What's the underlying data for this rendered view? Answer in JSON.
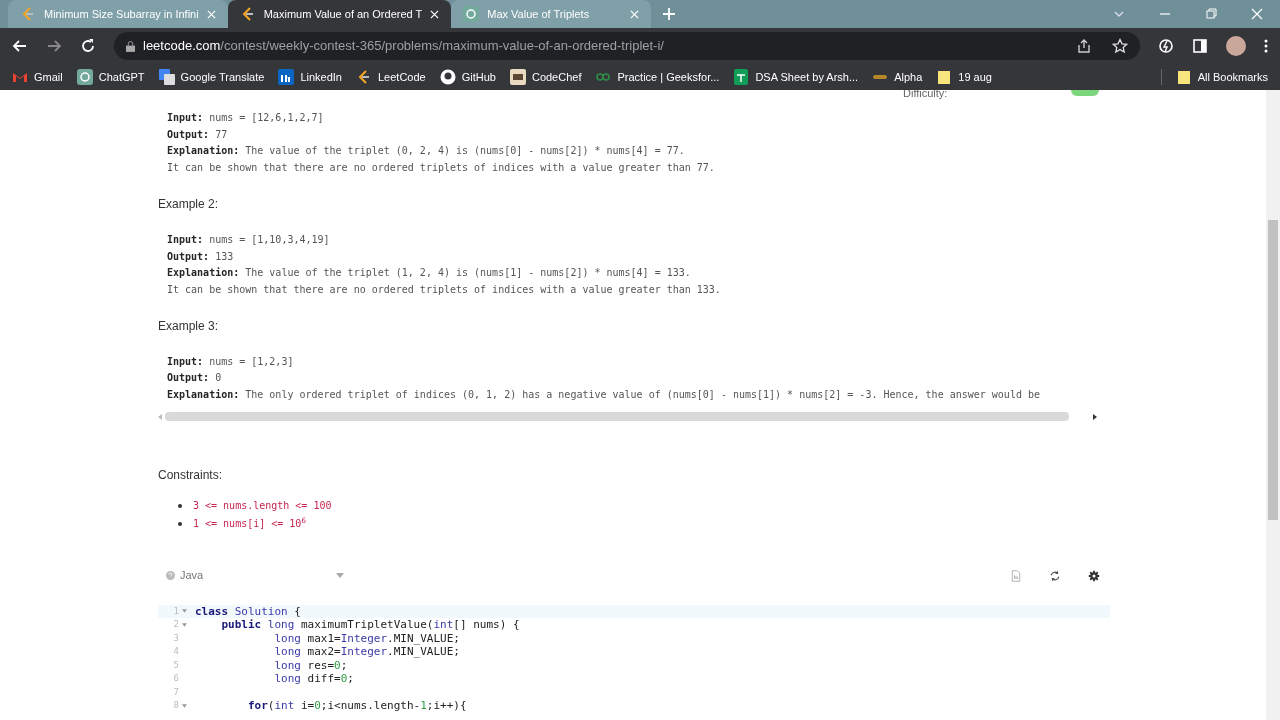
{
  "browser": {
    "tabs": [
      {
        "title": "Minimum Size Subarray in Infini",
        "selected": false
      },
      {
        "title": "Maximum Value of an Ordered T",
        "selected": true
      },
      {
        "title": "Max Value of Triplets",
        "selected": false
      }
    ],
    "url_domain": "leetcode.com",
    "url_path": "/contest/weekly-contest-365/problems/maximum-value-of-an-ordered-triplet-i/",
    "bookmarks": [
      "Gmail",
      "ChatGPT",
      "Google Translate",
      "LinkedIn",
      "LeetCode",
      "GitHub",
      "CodeChef",
      "Practice | Geeksfor...",
      "DSA Sheet by Arsh...",
      "Alpha",
      "19 aug"
    ],
    "all_bookmarks": "All Bookmarks"
  },
  "difficulty_label": "Difficulty:",
  "examples": [
    {
      "lines": [
        {
          "label": "Input:",
          "text": " nums = [12,6,1,2,7]"
        },
        {
          "label": "Output:",
          "text": " 77"
        },
        {
          "label": "Explanation:",
          "text": " The value of the triplet (0, 2, 4) is (nums[0] - nums[2]) * nums[4] = 77."
        },
        {
          "text": "It can be shown that there are no ordered triplets of indices with a value greater than 77."
        }
      ]
    },
    {
      "heading": "Example 2:",
      "lines": [
        {
          "label": "Input:",
          "text": " nums = [1,10,3,4,19]"
        },
        {
          "label": "Output:",
          "text": " 133"
        },
        {
          "label": "Explanation:",
          "text": " The value of the triplet (1, 2, 4) is (nums[1] - nums[2]) * nums[4] = 133."
        },
        {
          "text": "It can be shown that there are no ordered triplets of indices with a value greater than 133."
        }
      ]
    },
    {
      "heading": "Example 3:",
      "lines": [
        {
          "label": "Input:",
          "text": " nums = [1,2,3]"
        },
        {
          "label": "Output:",
          "text": " 0"
        },
        {
          "label": "Explanation:",
          "text": " The only ordered triplet of indices (0, 1, 2) has a negative value of (nums[0] - nums[1]) * nums[2] = -3. Hence, the answer would be"
        }
      ]
    }
  ],
  "constraints_heading": "Constraints:",
  "constraints": [
    "3 <= nums.length <= 100",
    "1 <= nums[i] <= 10$^{6}$"
  ],
  "editor": {
    "language": "Java",
    "lines": [
      {
        "number": "1",
        "fold": true,
        "tokens": [
          {
            "text": "class",
            "kind": "keyword"
          },
          {
            "text": " Solution",
            "kind": "type"
          },
          {
            "text": " {",
            "kind": "plain"
          }
        ]
      },
      {
        "number": "2",
        "fold": true,
        "tokens": [
          {
            "text": "    public",
            "kind": "keyword"
          },
          {
            "text": " long",
            "kind": "type"
          },
          {
            "text": " maximumTripletValue(",
            "kind": "plain"
          },
          {
            "text": "int",
            "kind": "type"
          },
          {
            "text": "[] nums) {",
            "kind": "plain"
          }
        ]
      },
      {
        "number": "3",
        "fold": false,
        "tokens": [
          {
            "text": "            long",
            "kind": "type"
          },
          {
            "text": " max1=",
            "kind": "plain"
          },
          {
            "text": "Integer",
            "kind": "type"
          },
          {
            "text": ".MIN_VALUE;",
            "kind": "plain"
          }
        ]
      },
      {
        "number": "4",
        "fold": false,
        "tokens": [
          {
            "text": "            long",
            "kind": "type"
          },
          {
            "text": " max2=",
            "kind": "plain"
          },
          {
            "text": "Integer",
            "kind": "type"
          },
          {
            "text": ".MIN_VALUE;",
            "kind": "plain"
          }
        ]
      },
      {
        "number": "5",
        "fold": false,
        "tokens": [
          {
            "text": "            long",
            "kind": "type"
          },
          {
            "text": " res=",
            "kind": "plain"
          },
          {
            "text": "0",
            "kind": "number"
          },
          {
            "text": ";",
            "kind": "plain"
          }
        ]
      },
      {
        "number": "6",
        "fold": false,
        "tokens": [
          {
            "text": "            long",
            "kind": "type"
          },
          {
            "text": " diff=",
            "kind": "plain"
          },
          {
            "text": "0",
            "kind": "number"
          },
          {
            "text": ";",
            "kind": "plain"
          }
        ]
      },
      {
        "number": "7",
        "fold": false
      },
      {
        "number": "8",
        "fold": true,
        "tokens": [
          {
            "text": "        for",
            "kind": "keyword"
          },
          {
            "text": "(",
            "kind": "plain"
          },
          {
            "text": "int",
            "kind": "type"
          },
          {
            "text": " i=",
            "kind": "plain"
          },
          {
            "text": "0",
            "kind": "number"
          },
          {
            "text": ";i<nums.length-",
            "kind": "plain"
          },
          {
            "text": "1",
            "kind": "number"
          },
          {
            "text": ";i++){",
            "kind": "plain"
          }
        ]
      }
    ]
  }
}
